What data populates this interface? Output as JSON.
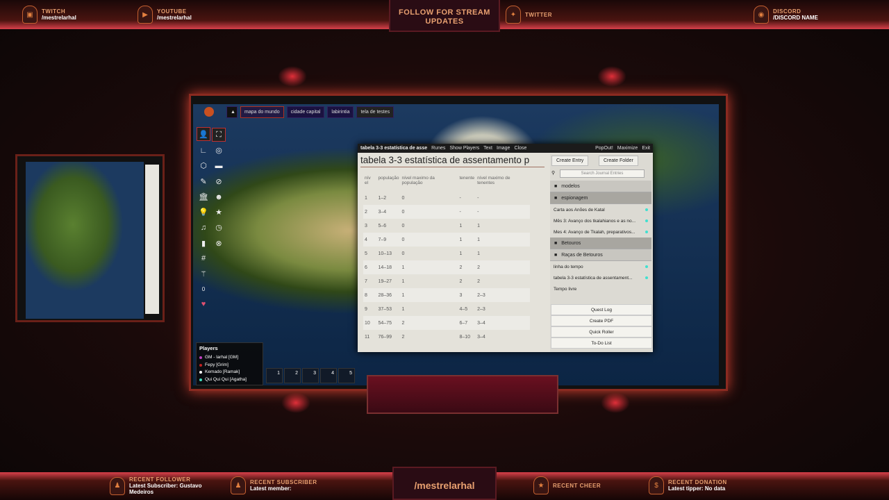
{
  "overlay": {
    "top": [
      {
        "label": "TWITCH",
        "value": "/mestrelarhal"
      },
      {
        "label": "YOUTUBE",
        "value": "/mestrelarhal"
      },
      {
        "label": "TWITTER",
        "value": ""
      },
      {
        "label": "DISCORD",
        "value": "/DISCORD NAME"
      }
    ],
    "center_top": "FOLLOW FOR STREAM UPDATES",
    "center_bottom": "/mestrelarhal",
    "bottom": [
      {
        "label": "RECENT FOLLOWER",
        "value": "Latest Subscriber: Gustavo Medeiros"
      },
      {
        "label": "RECENT SUBSCRIBER",
        "value": "Latest member:"
      },
      {
        "label": "RECENT CHEER",
        "value": ""
      },
      {
        "label": "RECENT DONATION",
        "value": "Latest tipper: No data"
      }
    ]
  },
  "scenes": [
    "mapa do mundo",
    "cidade capital",
    "labirintia",
    "tela de testes"
  ],
  "journal": {
    "header_title": "tabela 3-3 estatística de asse",
    "header_actions": [
      "Runes",
      "Show Players",
      "Text",
      "Image",
      "Close"
    ],
    "title": "tabela 3-3 estatística de assentamento p",
    "columns": [
      "nív el",
      "população",
      "nível maximo da população",
      "tenente",
      "nível maximo de tenentes"
    ],
    "rows": [
      [
        "1",
        "1–2",
        "0",
        "-",
        "-"
      ],
      [
        "2",
        "3–4",
        "0",
        "-",
        "-"
      ],
      [
        "3",
        "5–6",
        "0",
        "1",
        "1"
      ],
      [
        "4",
        "7–9",
        "0",
        "1",
        "1"
      ],
      [
        "5",
        "10–13",
        "0",
        "1",
        "1"
      ],
      [
        "6",
        "14–18",
        "1",
        "2",
        "2"
      ],
      [
        "7",
        "19–27",
        "1",
        "2",
        "2"
      ],
      [
        "8",
        "28–36",
        "1",
        "3",
        "2–3"
      ],
      [
        "9",
        "37–53",
        "1",
        "4–5",
        "2–3"
      ],
      [
        "10",
        "54–75",
        "2",
        "6–7",
        "3–4"
      ],
      [
        "11",
        "76–99",
        "2",
        "8–10",
        "3–4"
      ]
    ]
  },
  "sidebar": {
    "header_actions": [
      "PopOut!",
      "Maximize",
      "Exit"
    ],
    "create_entry": "Create Entry",
    "create_folder": "Create Folder",
    "search_placeholder": "Search Journal Entries",
    "folders": [
      {
        "name": "modelos",
        "entries": []
      },
      {
        "name": "espionagem",
        "entries": [
          "Carta aos Anões de Katal",
          "Mês 3: Avanço dos tkalahianos e as no...",
          "Mes 4: Avanço de Tkalah, preparativos..."
        ]
      },
      {
        "name": "Betouros",
        "entries": []
      },
      {
        "name": "Raças de Betouros",
        "entries": [
          "linha do tempo",
          "tabela 3-3 estatística de assentament..."
        ]
      }
    ],
    "loose": "Tempo livre",
    "buttons": [
      "Quest Log",
      "Create PDF",
      "Quick Roller",
      "To-Do List"
    ]
  },
  "players": {
    "title": "Players",
    "list": [
      {
        "name": "GM - larhal [GM]",
        "color": "#c040c0"
      },
      {
        "name": "Fepy [Grim]",
        "color": "#c02020"
      },
      {
        "name": "Kemado [Ramak]",
        "color": "#ffffff"
      },
      {
        "name": "Qui Qui Qui [Agatha]",
        "color": "#40e0c0"
      }
    ]
  },
  "hotbar": [
    "1",
    "2",
    "3",
    "4",
    "5"
  ],
  "tool_counter": "0"
}
